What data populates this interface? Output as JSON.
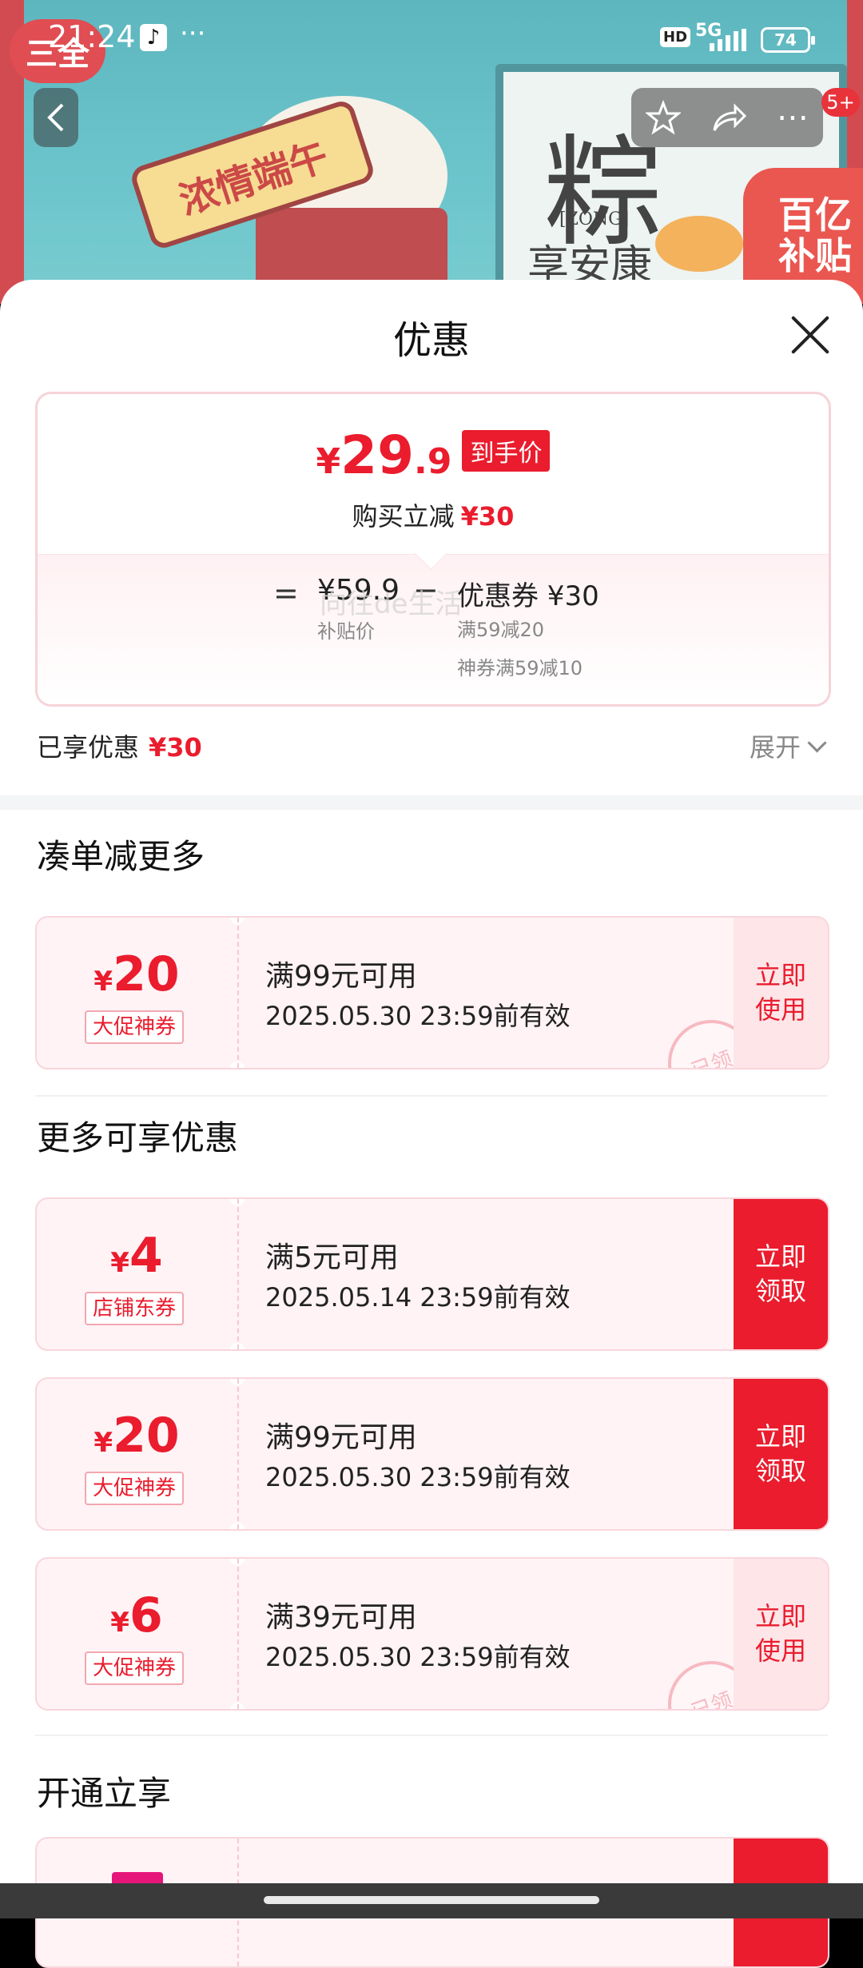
{
  "status_bar": {
    "time": "21:24",
    "app_icon": "tiktok-icon",
    "more": "···",
    "hd": "HD",
    "network": "5G",
    "battery": "74"
  },
  "banner": {
    "brand": "三全",
    "ribbon_text": "浓情端午",
    "product_char": "粽",
    "product_en": "[ZONG]",
    "product_name": "享安康",
    "subsidy_line1": "百亿",
    "subsidy_line2": "补贴",
    "cart_badge": "5+"
  },
  "sheet": {
    "title": "优惠",
    "close_icon": "close-icon"
  },
  "price_card": {
    "currency": "¥",
    "final_int": "29",
    "final_dec": ".9",
    "final_tag": "到手价",
    "reduce_label": "购买立减",
    "reduce_amount": "¥30",
    "eq": "=",
    "base_price": "¥59.9",
    "base_label": "补贴价",
    "minus": "−",
    "coupon_total": "优惠券 ¥30",
    "coupon_detail_1": "满59减20",
    "coupon_detail_2": "神券满59减10"
  },
  "enjoyed": {
    "label": "已享优惠",
    "amount": "¥30",
    "expand_label": "展开"
  },
  "watermark": "向往de生活",
  "sections": {
    "more_discount": "凑单减更多",
    "more_offers": "更多可享优惠",
    "open_enjoy": "开通立享"
  },
  "coupons": [
    {
      "currency": "¥",
      "amount": "20",
      "type": "大促神券",
      "condition": "满99元可用",
      "validity": "2025.05.30 23:59前有效",
      "action": "立即使用",
      "action_l1": "立即",
      "action_l2": "使用",
      "stamp": "已领"
    },
    {
      "currency": "¥",
      "amount": "4",
      "type": "店铺东券",
      "condition": "满5元可用",
      "validity": "2025.05.14 23:59前有效",
      "action": "立即领取",
      "action_l1": "立即",
      "action_l2": "领取"
    },
    {
      "currency": "¥",
      "amount": "20",
      "type": "大促神券",
      "condition": "满99元可用",
      "validity": "2025.05.30 23:59前有效",
      "action": "立即领取",
      "action_l1": "立即",
      "action_l2": "领取"
    },
    {
      "currency": "¥",
      "amount": "6",
      "type": "大促神券",
      "condition": "满39元可用",
      "validity": "2025.05.30 23:59前有效",
      "action": "立即使用",
      "action_l1": "立即",
      "action_l2": "使用",
      "stamp": "已领"
    }
  ],
  "colors": {
    "accent_red": "#ea1c2d",
    "coupon_bg": "#fff3f5"
  }
}
